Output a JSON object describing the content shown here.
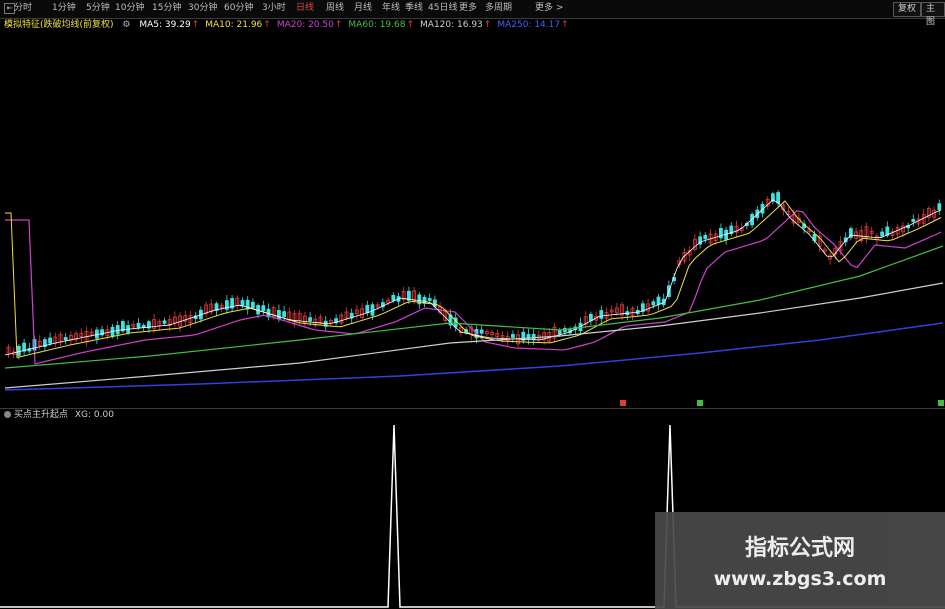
{
  "toolbar": {
    "first_icon": "⇤",
    "buttons": [
      "分时",
      "1分钟",
      "5分钟",
      "10分钟",
      "15分钟",
      "30分钟",
      "60分钟",
      "3小时",
      "日线",
      "周线",
      "月线",
      "年线",
      "季线",
      "45日线",
      "更多",
      "多周期",
      "更多 >"
    ],
    "active_index": 8,
    "right_buttons": [
      "复权",
      "主图"
    ]
  },
  "ma_info": {
    "name": "模拟特征(跌破均线(前复权)",
    "items": [
      {
        "label": "MA5: 39.29",
        "color": "#ffffff"
      },
      {
        "label": "MA10: 21.96",
        "color": "#f0e040"
      },
      {
        "label": "MA20: 20.50",
        "color": "#d040d0"
      },
      {
        "label": "MA60: 19.68",
        "color": "#40c040"
      },
      {
        "label": "MA120: 16.93",
        "color": "#cfcfcf"
      },
      {
        "label": "MA250: 14.17",
        "color": "#4060ff"
      }
    ]
  },
  "indicator": {
    "label": "买点主升起点",
    "value": "XG: 0.00"
  },
  "watermark": {
    "title": "指标公式网",
    "url": "www.zbgs3.com"
  },
  "colors": {
    "up_candle": "#e23a3a",
    "down_candle": "#40e0e0",
    "ma5": "#ffffff",
    "ma10": "#f0e040",
    "ma20": "#d040d0",
    "ma60": "#40c040",
    "ma120": "#cfcfcf",
    "ma250": "#3040e0",
    "signal": "#ffffff"
  }
}
